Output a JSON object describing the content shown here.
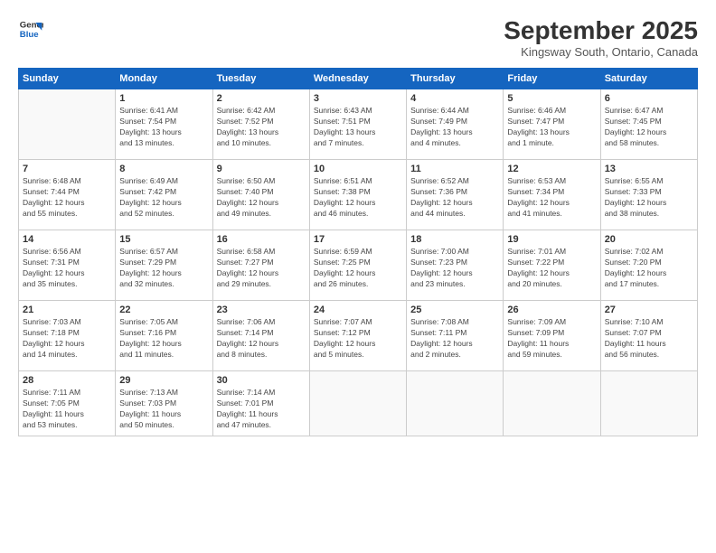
{
  "logo": {
    "line1": "General",
    "line2": "Blue"
  },
  "title": "September 2025",
  "subtitle": "Kingsway South, Ontario, Canada",
  "weekdays": [
    "Sunday",
    "Monday",
    "Tuesday",
    "Wednesday",
    "Thursday",
    "Friday",
    "Saturday"
  ],
  "weeks": [
    [
      {
        "day": null,
        "info": null
      },
      {
        "day": "1",
        "info": "Sunrise: 6:41 AM\nSunset: 7:54 PM\nDaylight: 13 hours\nand 13 minutes."
      },
      {
        "day": "2",
        "info": "Sunrise: 6:42 AM\nSunset: 7:52 PM\nDaylight: 13 hours\nand 10 minutes."
      },
      {
        "day": "3",
        "info": "Sunrise: 6:43 AM\nSunset: 7:51 PM\nDaylight: 13 hours\nand 7 minutes."
      },
      {
        "day": "4",
        "info": "Sunrise: 6:44 AM\nSunset: 7:49 PM\nDaylight: 13 hours\nand 4 minutes."
      },
      {
        "day": "5",
        "info": "Sunrise: 6:46 AM\nSunset: 7:47 PM\nDaylight: 13 hours\nand 1 minute."
      },
      {
        "day": "6",
        "info": "Sunrise: 6:47 AM\nSunset: 7:45 PM\nDaylight: 12 hours\nand 58 minutes."
      }
    ],
    [
      {
        "day": "7",
        "info": "Sunrise: 6:48 AM\nSunset: 7:44 PM\nDaylight: 12 hours\nand 55 minutes."
      },
      {
        "day": "8",
        "info": "Sunrise: 6:49 AM\nSunset: 7:42 PM\nDaylight: 12 hours\nand 52 minutes."
      },
      {
        "day": "9",
        "info": "Sunrise: 6:50 AM\nSunset: 7:40 PM\nDaylight: 12 hours\nand 49 minutes."
      },
      {
        "day": "10",
        "info": "Sunrise: 6:51 AM\nSunset: 7:38 PM\nDaylight: 12 hours\nand 46 minutes."
      },
      {
        "day": "11",
        "info": "Sunrise: 6:52 AM\nSunset: 7:36 PM\nDaylight: 12 hours\nand 44 minutes."
      },
      {
        "day": "12",
        "info": "Sunrise: 6:53 AM\nSunset: 7:34 PM\nDaylight: 12 hours\nand 41 minutes."
      },
      {
        "day": "13",
        "info": "Sunrise: 6:55 AM\nSunset: 7:33 PM\nDaylight: 12 hours\nand 38 minutes."
      }
    ],
    [
      {
        "day": "14",
        "info": "Sunrise: 6:56 AM\nSunset: 7:31 PM\nDaylight: 12 hours\nand 35 minutes."
      },
      {
        "day": "15",
        "info": "Sunrise: 6:57 AM\nSunset: 7:29 PM\nDaylight: 12 hours\nand 32 minutes."
      },
      {
        "day": "16",
        "info": "Sunrise: 6:58 AM\nSunset: 7:27 PM\nDaylight: 12 hours\nand 29 minutes."
      },
      {
        "day": "17",
        "info": "Sunrise: 6:59 AM\nSunset: 7:25 PM\nDaylight: 12 hours\nand 26 minutes."
      },
      {
        "day": "18",
        "info": "Sunrise: 7:00 AM\nSunset: 7:23 PM\nDaylight: 12 hours\nand 23 minutes."
      },
      {
        "day": "19",
        "info": "Sunrise: 7:01 AM\nSunset: 7:22 PM\nDaylight: 12 hours\nand 20 minutes."
      },
      {
        "day": "20",
        "info": "Sunrise: 7:02 AM\nSunset: 7:20 PM\nDaylight: 12 hours\nand 17 minutes."
      }
    ],
    [
      {
        "day": "21",
        "info": "Sunrise: 7:03 AM\nSunset: 7:18 PM\nDaylight: 12 hours\nand 14 minutes."
      },
      {
        "day": "22",
        "info": "Sunrise: 7:05 AM\nSunset: 7:16 PM\nDaylight: 12 hours\nand 11 minutes."
      },
      {
        "day": "23",
        "info": "Sunrise: 7:06 AM\nSunset: 7:14 PM\nDaylight: 12 hours\nand 8 minutes."
      },
      {
        "day": "24",
        "info": "Sunrise: 7:07 AM\nSunset: 7:12 PM\nDaylight: 12 hours\nand 5 minutes."
      },
      {
        "day": "25",
        "info": "Sunrise: 7:08 AM\nSunset: 7:11 PM\nDaylight: 12 hours\nand 2 minutes."
      },
      {
        "day": "26",
        "info": "Sunrise: 7:09 AM\nSunset: 7:09 PM\nDaylight: 11 hours\nand 59 minutes."
      },
      {
        "day": "27",
        "info": "Sunrise: 7:10 AM\nSunset: 7:07 PM\nDaylight: 11 hours\nand 56 minutes."
      }
    ],
    [
      {
        "day": "28",
        "info": "Sunrise: 7:11 AM\nSunset: 7:05 PM\nDaylight: 11 hours\nand 53 minutes."
      },
      {
        "day": "29",
        "info": "Sunrise: 7:13 AM\nSunset: 7:03 PM\nDaylight: 11 hours\nand 50 minutes."
      },
      {
        "day": "30",
        "info": "Sunrise: 7:14 AM\nSunset: 7:01 PM\nDaylight: 11 hours\nand 47 minutes."
      },
      {
        "day": null,
        "info": null
      },
      {
        "day": null,
        "info": null
      },
      {
        "day": null,
        "info": null
      },
      {
        "day": null,
        "info": null
      }
    ]
  ]
}
